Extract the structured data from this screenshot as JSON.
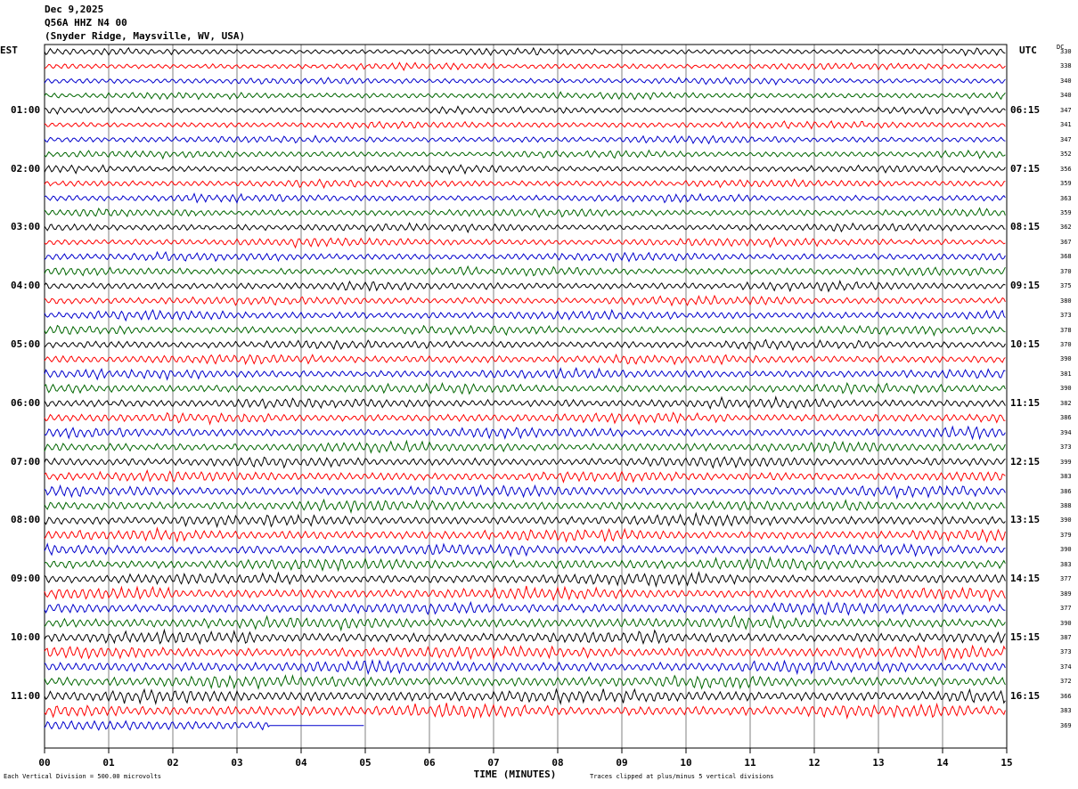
{
  "header": {
    "date": "Dec 9,2025",
    "station": "Q56A HHZ N4 00",
    "location": "(Snyder Ridge, Maysville, WV, USA)"
  },
  "left_zone": "EST",
  "right_zone": "UTC",
  "dc_label": "DC",
  "footer": {
    "scale": "Each Vertical Division =  500.00 microvolts",
    "clip": "Traces clipped at plus/minus 5 vertical divisions"
  },
  "colors": {
    "trace_cycle": [
      "#000000",
      "#ff0000",
      "#0000cc",
      "#006600"
    ],
    "grid": "#808080"
  },
  "chart_data": {
    "type": "line",
    "xlabel": "TIME (MINUTES)",
    "xlim": [
      0,
      15
    ],
    "x_ticks": [
      "00",
      "01",
      "02",
      "03",
      "04",
      "05",
      "06",
      "07",
      "08",
      "09",
      "10",
      "11",
      "12",
      "13",
      "14",
      "15"
    ],
    "rows_est": [
      "",
      "",
      "",
      "",
      "01:00",
      "",
      "",
      "",
      "02:00",
      "",
      "",
      "",
      "03:00",
      "",
      "",
      "",
      "04:00",
      "",
      "",
      "",
      "05:00",
      "",
      "",
      "",
      "06:00",
      "",
      "",
      "",
      "07:00",
      "",
      "",
      "",
      "08:00",
      "",
      "",
      "",
      "09:00",
      "",
      "",
      "",
      "10:00",
      "",
      "",
      "",
      "11:00",
      "",
      ""
    ],
    "rows_utc": [
      "",
      "",
      "",
      "",
      "06:15",
      "",
      "",
      "",
      "07:15",
      "",
      "",
      "",
      "08:15",
      "",
      "",
      "",
      "09:15",
      "",
      "",
      "",
      "10:15",
      "",
      "",
      "",
      "11:15",
      "",
      "",
      "",
      "12:15",
      "",
      "",
      "",
      "13:15",
      "",
      "",
      "",
      "14:15",
      "",
      "",
      "",
      "15:15",
      "",
      "",
      "",
      "16:15",
      "",
      ""
    ],
    "dc_offsets": [
      "330",
      "338",
      "340",
      "340",
      "347",
      "341",
      "347",
      "352",
      "356",
      "359",
      "363",
      "359",
      "362",
      "367",
      "368",
      "370",
      "375",
      "380",
      "373",
      "378",
      "370",
      "390",
      "381",
      "390",
      "382",
      "386",
      "394",
      "373",
      "399",
      "383",
      "386",
      "388",
      "390",
      "379",
      "390",
      "383",
      "377",
      "389",
      "377",
      "390",
      "387",
      "373",
      "374",
      "372",
      "366",
      "383",
      "369"
    ],
    "row_minutes": 15,
    "last_row_end_minute": 5.0,
    "last_row_flat_from_minute": 3.5
  }
}
